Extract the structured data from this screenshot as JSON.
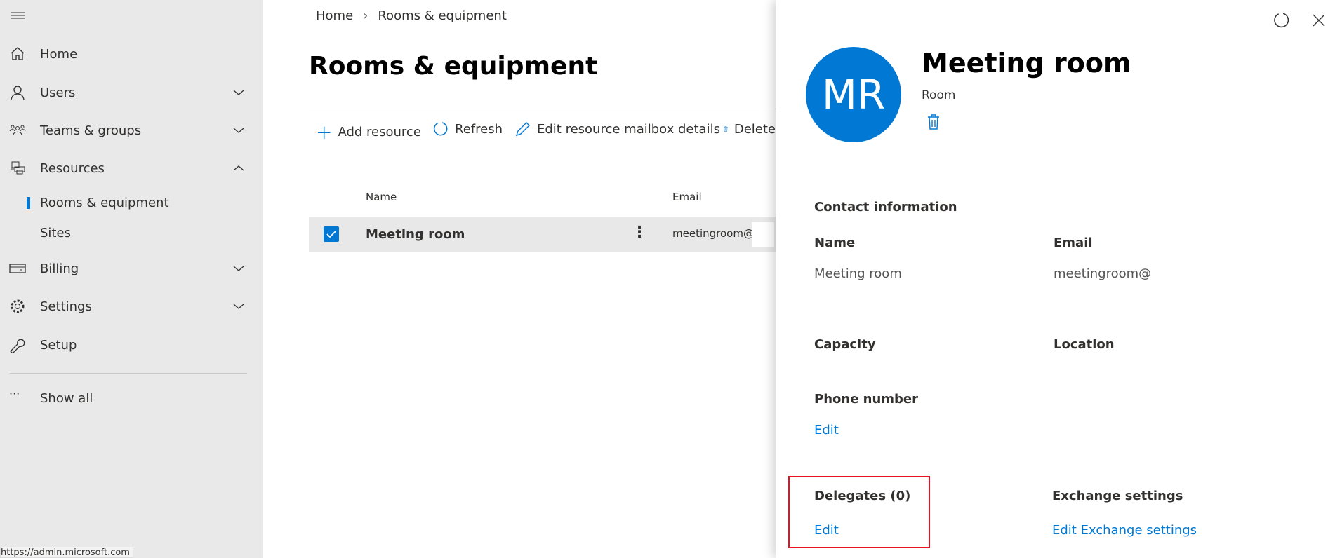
{
  "sidebar": {
    "items": [
      {
        "label": "Home",
        "icon": "home-icon"
      },
      {
        "label": "Users",
        "icon": "user-icon",
        "expanded": false
      },
      {
        "label": "Teams & groups",
        "icon": "teams-icon",
        "expanded": false
      },
      {
        "label": "Resources",
        "icon": "resources-icon",
        "expanded": true
      },
      {
        "label": "Billing",
        "icon": "billing-icon",
        "expanded": false
      },
      {
        "label": "Settings",
        "icon": "gear-icon",
        "expanded": false
      },
      {
        "label": "Setup",
        "icon": "wrench-icon"
      },
      {
        "label": "Show all",
        "icon": "more-icon"
      }
    ],
    "subitems": [
      {
        "label": "Rooms & equipment",
        "active": true
      },
      {
        "label": "Sites"
      }
    ]
  },
  "breadcrumb": {
    "home": "Home",
    "current": "Rooms & equipment"
  },
  "page_title": "Rooms & equipment",
  "toolbar": {
    "add": "Add resource",
    "refresh": "Refresh",
    "edit": "Edit resource mailbox details",
    "delete": "Delete"
  },
  "table": {
    "columns": [
      "Name",
      "Email"
    ],
    "rows": [
      {
        "name": "Meeting room",
        "email": "meetingroom@",
        "selected": true
      }
    ]
  },
  "panel": {
    "initials": "MR",
    "title": "Meeting room",
    "type": "Room",
    "contact_heading": "Contact information",
    "name_label": "Name",
    "name_value": "Meeting room",
    "email_label": "Email",
    "email_value": "meetingroom@",
    "capacity_label": "Capacity",
    "location_label": "Location",
    "phone_label": "Phone number",
    "phone_edit": "Edit",
    "delegates_label": "Delegates (0)",
    "delegates_edit": "Edit",
    "exchange_label": "Exchange settings",
    "exchange_edit": "Edit Exchange settings"
  },
  "status_url": "https://admin.microsoft.com",
  "colors": {
    "accent": "#0078d4",
    "highlight": "#e81123"
  }
}
